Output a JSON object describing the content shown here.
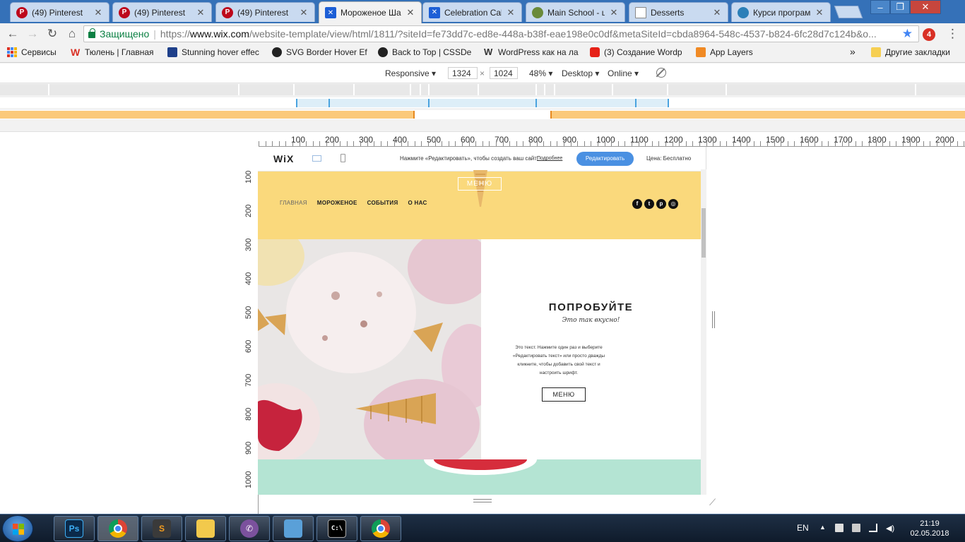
{
  "browser": {
    "tabs": [
      {
        "title": "(49) Pinterest",
        "favicon": "pinterest-icon",
        "active": false
      },
      {
        "title": "(49) Pinterest",
        "favicon": "pinterest-icon",
        "active": false
      },
      {
        "title": "(49) Pinterest",
        "favicon": "pinterest-icon",
        "active": false
      },
      {
        "title": "Мороженое Ша",
        "favicon": "wix-icon",
        "active": true
      },
      {
        "title": "Celebration Cak",
        "favicon": "wix-icon",
        "active": false
      },
      {
        "title": "Main School - ш",
        "favicon": "school-icon",
        "active": false
      },
      {
        "title": "Desserts",
        "favicon": "document-icon",
        "active": false
      },
      {
        "title": "Курси програм",
        "favicon": "globe-icon",
        "active": false
      }
    ],
    "omnibox": {
      "secure_label": "Защищено",
      "url_scheme": "https://",
      "url_host": "www.wix.com",
      "url_rest": "/website-template/view/html/1811/?siteId=fe73dd7c-ed8e-448a-b38f-eae198e0c0df&metaSiteId=cbda8964-548c-4537-b824-6fc28d7c124b&o..."
    },
    "extension_badge": "4",
    "bookmarks": [
      {
        "label": "Сервисы"
      },
      {
        "label": "Тюлень | Главная"
      },
      {
        "label": "Stunning hover effec"
      },
      {
        "label": "SVG Border Hover Ef"
      },
      {
        "label": "Back to Top | CSSDe"
      },
      {
        "label": "WordPress как на ла"
      },
      {
        "label": "(3) Создание Wordp"
      },
      {
        "label": "App Layers"
      }
    ],
    "bookmarks_overflow": "»",
    "other_bookmarks": "Другие закладки"
  },
  "devtools": {
    "device": "Responsive",
    "width": "1324",
    "times": "×",
    "height": "1024",
    "zoom": "48%",
    "mode": "Desktop",
    "network": "Online",
    "ruler_h_labels": [
      "100",
      "200",
      "300",
      "400",
      "500",
      "600",
      "700",
      "800",
      "900",
      "1000",
      "1100",
      "1200",
      "1300",
      "1400",
      "1500",
      "1600",
      "1700",
      "1800",
      "1900",
      "2000"
    ],
    "ruler_v_labels": [
      "100",
      "200",
      "300",
      "400",
      "500",
      "600",
      "700",
      "800",
      "900",
      "1000"
    ]
  },
  "wix_bar": {
    "logo": "WiX",
    "message": "Нажмите «Редактировать», чтобы создать ваш сайт!",
    "more_link": "Подробнее",
    "edit_button": "Редактировать",
    "price": "Цена: Бесплатно"
  },
  "site": {
    "menu_button": "МЕНЮ",
    "nav": [
      "ГЛАВНАЯ",
      "МОРОЖЕНОЕ",
      "СОБЫТИЯ",
      "О НАС"
    ],
    "social": [
      {
        "name": "facebook-icon",
        "glyph": "f"
      },
      {
        "name": "twitter-icon",
        "glyph": "t"
      },
      {
        "name": "pinterest-icon",
        "glyph": "p"
      },
      {
        "name": "instagram-icon",
        "glyph": "◎"
      }
    ],
    "hero": {
      "title": "ПОПРОБУЙТЕ",
      "subtitle": "Это так вкусно!",
      "body": "Это текст. Нажмите один раз и выберите «Редактировать текст» или просто дважды кликните, чтобы добавить свой текст и настроить шрифт.",
      "button": "МЕНЮ"
    }
  },
  "taskbar": {
    "language": "EN",
    "time": "21:19",
    "date": "02.05.2018",
    "apps": [
      "photoshop",
      "chrome",
      "sublime-text",
      "explorer",
      "viber",
      "control-panel",
      "cmd",
      "chrome"
    ]
  },
  "colors": {
    "header_yellow": "#fad97c",
    "mint": "#b4e4d3",
    "wix_blue": "#4a90e2",
    "titlebar_blue": "#3571b8"
  }
}
